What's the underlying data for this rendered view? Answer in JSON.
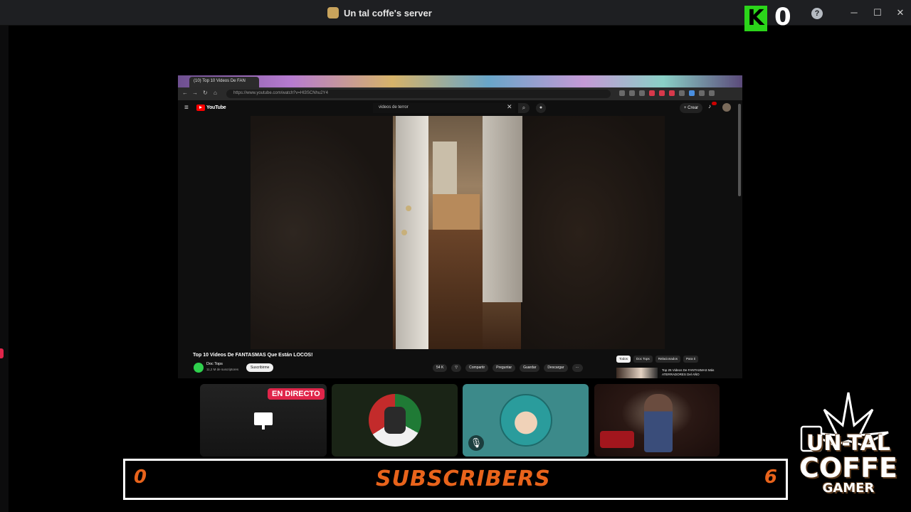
{
  "window": {
    "title": "Un tal coffe's server",
    "kick_logo_letter": "K",
    "kick_viewer_count": "0",
    "help_glyph": "?",
    "minimize_glyph": "─",
    "maximize_glyph": "☐",
    "close_glyph": "✕"
  },
  "browser": {
    "active_tab_title": "(10) Top 10 Videos De FAN",
    "address": "https://www.youtube.com/watch?v=Hl3SCNhu2Y4"
  },
  "youtube": {
    "logo_text": "YouTube",
    "menu_glyph": "≡",
    "search_query": "videos de terror",
    "create_label": "+ Crear",
    "video_title": "Top 10 Videos De FANTASMAS Que Están LOCOS!",
    "channel_name": "Doc Tops",
    "channel_subs": "11,2 M de suscriptores",
    "subscribe_label": "Suscribirme",
    "actions": [
      "54 K",
      "",
      "Compartir",
      "Preguntar",
      "Guardar",
      "Descargar",
      "···"
    ],
    "chips": [
      "Todos",
      "Doc Tops",
      "Relacionados",
      "Para ti"
    ],
    "rec_title": "Top 25 Videos De FANTASMAS Más ATERRADORES Del AÑO"
  },
  "participants": {
    "live_badge": "EN DIRECTO",
    "mute_glyph": "🎙"
  },
  "subscriber_bar": {
    "left_value": "0",
    "label": "SUBSCRIBERS",
    "right_value": "6"
  },
  "logo": {
    "line1": "UN-TAL",
    "line2": "COFFE",
    "line3": "GAMER"
  }
}
